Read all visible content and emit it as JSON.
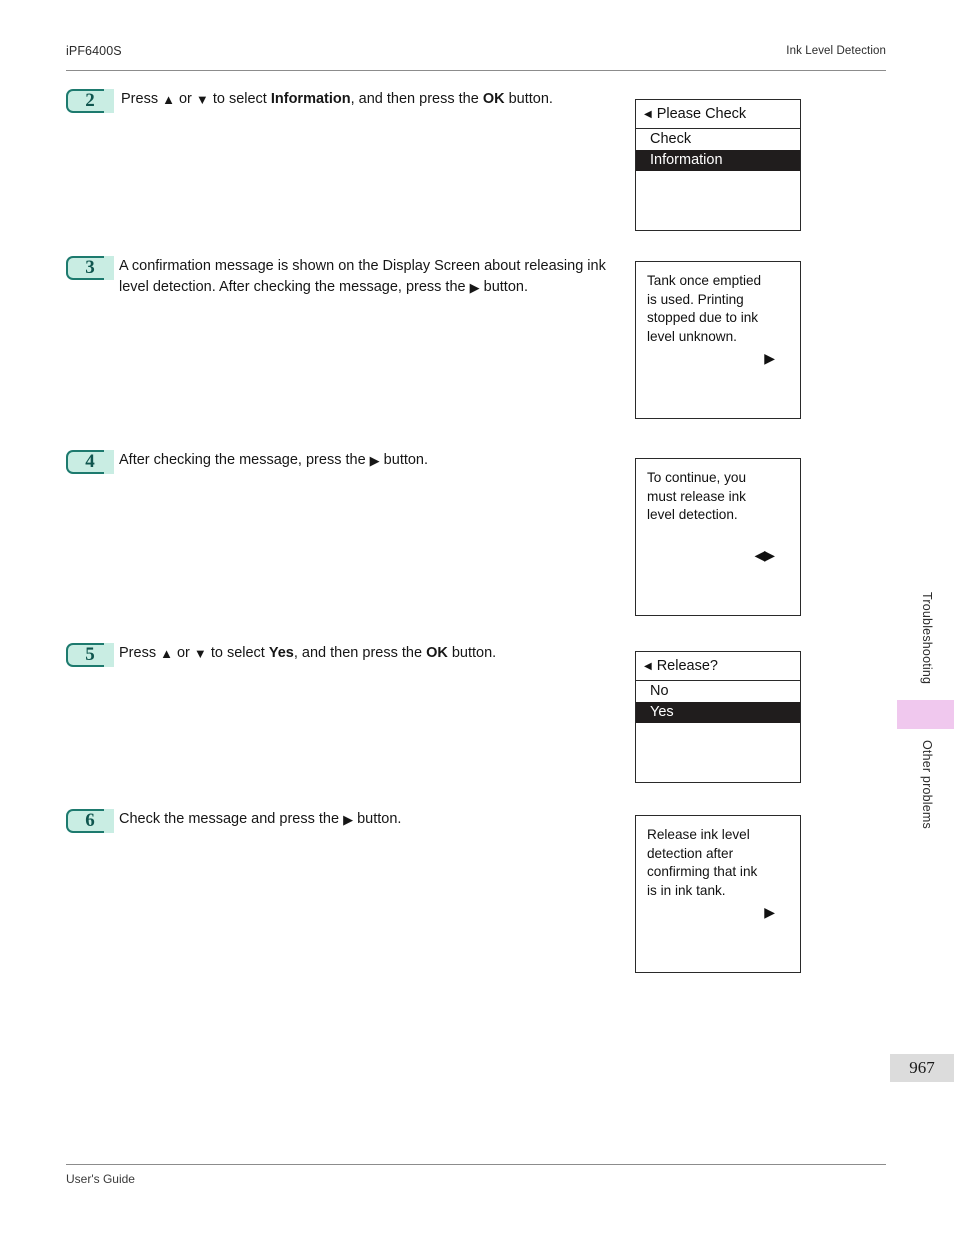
{
  "header": {
    "model": "iPF6400S",
    "section": "Ink Level Detection"
  },
  "footer": {
    "guide_label": "User's Guide",
    "page_number": "967"
  },
  "side_tabs": {
    "tab1": "Troubleshooting",
    "tab2": "Other problems",
    "marker_color": "#f0c8ee"
  },
  "colors": {
    "badge_fill": "#c9ede3",
    "badge_border": "#1d7a6e",
    "badge_text": "#10564f",
    "lcd_highlight": "#201d1d"
  },
  "steps": [
    {
      "number": "2",
      "text_prefix": "Press ",
      "up_arrow": "▲",
      "text_or": " or ",
      "down_arrow": "▼",
      "text_mid": " to select ",
      "bold1": "Information",
      "text_mid2": ", and then press the ",
      "bold2": "OK",
      "text_suffix": " button.",
      "panel": {
        "type": "menu",
        "title_arrow": "◀",
        "title": "Please Check",
        "rows": [
          {
            "label": "Check",
            "selected": false
          },
          {
            "label": "Information",
            "selected": true
          }
        ]
      }
    },
    {
      "number": "3",
      "line1": "A confirmation message is shown on the Display Screen about releasing",
      "line2_a": "ink level detection. After checking the message, press the ",
      "line2_arrow": "▶",
      "line2_b": " button.",
      "panel": {
        "type": "message",
        "lines": [
          "Tank once emptied",
          "is used. Printing",
          "stopped due to ink",
          "level unknown."
        ],
        "indicator": "▶"
      }
    },
    {
      "number": "4",
      "text_prefix": "After checking the message, press the ",
      "arrow": "▶",
      "text_suffix": " button.",
      "panel": {
        "type": "message",
        "lines": [
          "To continue, you",
          "must release ink",
          "level detection."
        ],
        "indicator": "◀▶"
      }
    },
    {
      "number": "5",
      "text_prefix": "Press ",
      "up_arrow": "▲",
      "text_or": " or ",
      "down_arrow": "▼",
      "text_mid": " to select ",
      "bold1": "Yes",
      "text_mid2": ", and then press the ",
      "bold2": "OK",
      "text_suffix": " button.",
      "panel": {
        "type": "menu",
        "title_arrow": "◀",
        "title": "Release?",
        "rows": [
          {
            "label": "No",
            "selected": false
          },
          {
            "label": "Yes",
            "selected": true
          }
        ]
      }
    },
    {
      "number": "6",
      "text_prefix": "Check the message and press the ",
      "arrow": "▶",
      "text_suffix": " button.",
      "panel": {
        "type": "message",
        "lines": [
          "Release ink level",
          "detection after",
          "confirming that ink",
          "is in ink tank."
        ],
        "indicator": "▶"
      }
    }
  ]
}
